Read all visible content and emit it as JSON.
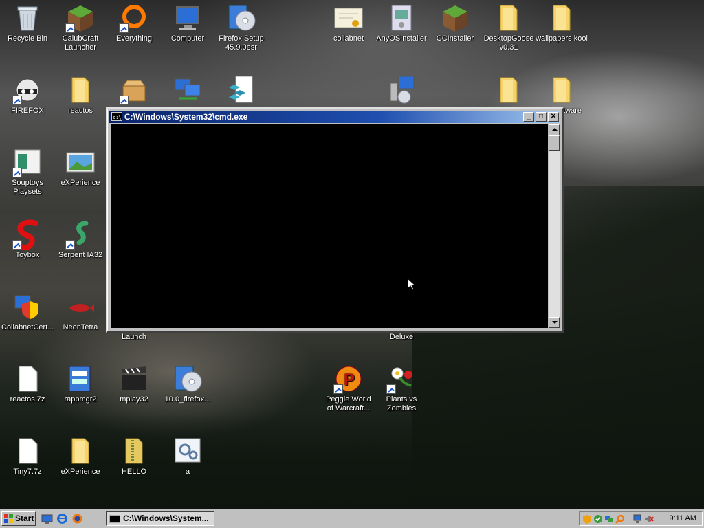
{
  "desktop": {
    "icons": [
      {
        "label": "Recycle Bin"
      },
      {
        "label": "CalubCraft\nLauncher"
      },
      {
        "label": "Everything"
      },
      {
        "label": "Computer"
      },
      {
        "label": "Firefox Setup\n45.9.0esr"
      },
      {
        "label": "collabnet"
      },
      {
        "label": "AnyOSInstaller"
      },
      {
        "label": "CCInstaller"
      },
      {
        "label": "DesktopGoose\nv0.31"
      },
      {
        "label": "wallpapers kool"
      },
      {
        "label": "FIREFOX"
      },
      {
        "label": "reactos"
      },
      {
        "label": "ftware"
      },
      {
        "label": "Souptoys\nPlaysets"
      },
      {
        "label": "eXPerience"
      },
      {
        "label": "Toybox"
      },
      {
        "label": "Serpent IA32"
      },
      {
        "label": "CollabnetCert..."
      },
      {
        "label": "NeonTetra"
      },
      {
        "label": "Launch"
      },
      {
        "label": "Deluxe"
      },
      {
        "label": "reactos.7z"
      },
      {
        "label": "rappmgr2"
      },
      {
        "label": "mplay32"
      },
      {
        "label": "10.0_firefox..."
      },
      {
        "label": "Peggle World\nof Warcraft..."
      },
      {
        "label": "Plants vs\nZombies"
      },
      {
        "label": "Tiny7.7z"
      },
      {
        "label": "eXPerience"
      },
      {
        "label": "HELLO"
      },
      {
        "label": "a"
      }
    ]
  },
  "window": {
    "title": "C:\\Windows\\System32\\cmd.exe",
    "minimize": "_",
    "maximize": "□",
    "close": "✕"
  },
  "taskbar": {
    "start_label": "Start",
    "task_label": "C:\\Windows\\System...",
    "clock": "9:11 AM"
  },
  "colors": {
    "titlebar_start": "#0a246a",
    "titlebar_end": "#a6caf0",
    "face": "#c0c0c0",
    "console_bg": "#000000"
  }
}
